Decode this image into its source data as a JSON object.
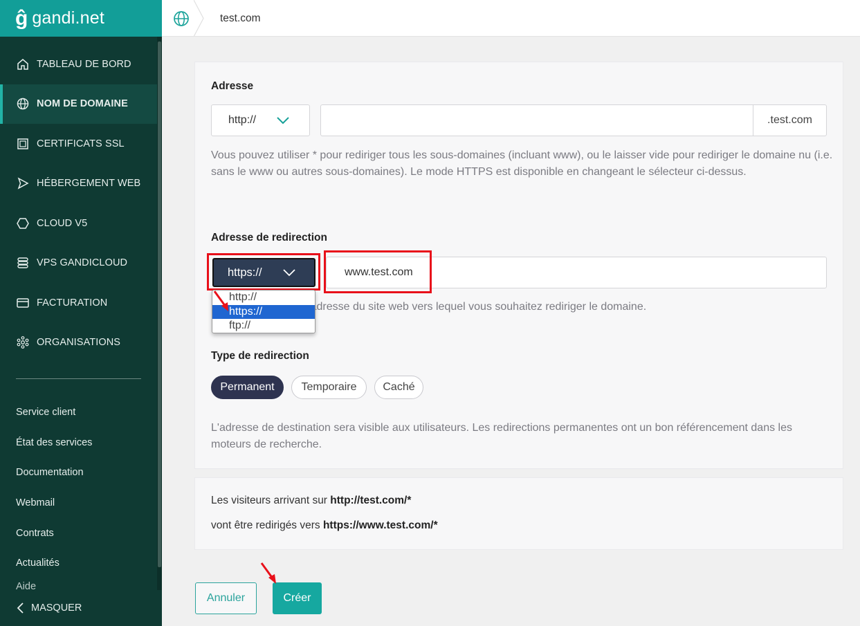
{
  "brand": {
    "logo_mark": "ĝ",
    "logo_text": "gandi.net",
    "accent": "#129e98",
    "sidebar_bg": "#0f3a33"
  },
  "topbar": {
    "breadcrumb": "test.com"
  },
  "sidebar": {
    "items": [
      {
        "label": "TABLEAU DE BORD",
        "icon": "home-icon",
        "active": false
      },
      {
        "label": "NOM DE DOMAINE",
        "icon": "globe-icon",
        "active": true
      },
      {
        "label": "CERTIFICATS SSL",
        "icon": "certificate-icon",
        "active": false
      },
      {
        "label": "HÉBERGEMENT WEB",
        "icon": "send-icon",
        "active": false
      },
      {
        "label": "CLOUD V5",
        "icon": "hexagon-icon",
        "active": false
      },
      {
        "label": "VPS GANDICLOUD",
        "icon": "server-icon",
        "active": false
      },
      {
        "label": "FACTURATION",
        "icon": "card-icon",
        "active": false
      },
      {
        "label": "ORGANISATIONS",
        "icon": "network-icon",
        "active": false
      }
    ],
    "links": [
      "Service client",
      "État des services",
      "Documentation",
      "Webmail",
      "Contrats",
      "Actualités",
      "Aide"
    ],
    "hide_label": "MASQUER"
  },
  "form": {
    "address": {
      "label": "Adresse",
      "protocol": "http://",
      "value": "",
      "suffix": ".test.com",
      "help": "Vous pouvez utiliser * pour rediriger tous les sous-domaines (incluant www), ou le laisser vide pour rediriger le domaine nu (i.e. sans le www ou autres sous-domaines). Le mode HTTPS est disponible en changeant le sélecteur ci-dessus."
    },
    "redirect": {
      "label": "Adresse de redirection",
      "protocol": "https://",
      "value": "www.test.com",
      "options": [
        "http://",
        "https://",
        "ftp://"
      ],
      "help": "Indiquez ci-dessus l'adresse du site web vers lequel vous souhaitez rediriger le domaine."
    },
    "type": {
      "label": "Type de redirection",
      "options": [
        "Permanent",
        "Temporaire",
        "Caché"
      ],
      "selected": "Permanent",
      "help": "L'adresse de destination sera visible aux utilisateurs. Les redirections permanentes ont un bon référencement dans les moteurs de recherche."
    }
  },
  "summary": {
    "line1_prefix": "Les visiteurs arrivant sur ",
    "line1_value": "http://test.com/*",
    "line2_prefix": "vont être redirigés vers ",
    "line2_value": "https://www.test.com/*"
  },
  "actions": {
    "cancel": "Annuler",
    "create": "Créer"
  },
  "annotation_color": "#e8101a"
}
